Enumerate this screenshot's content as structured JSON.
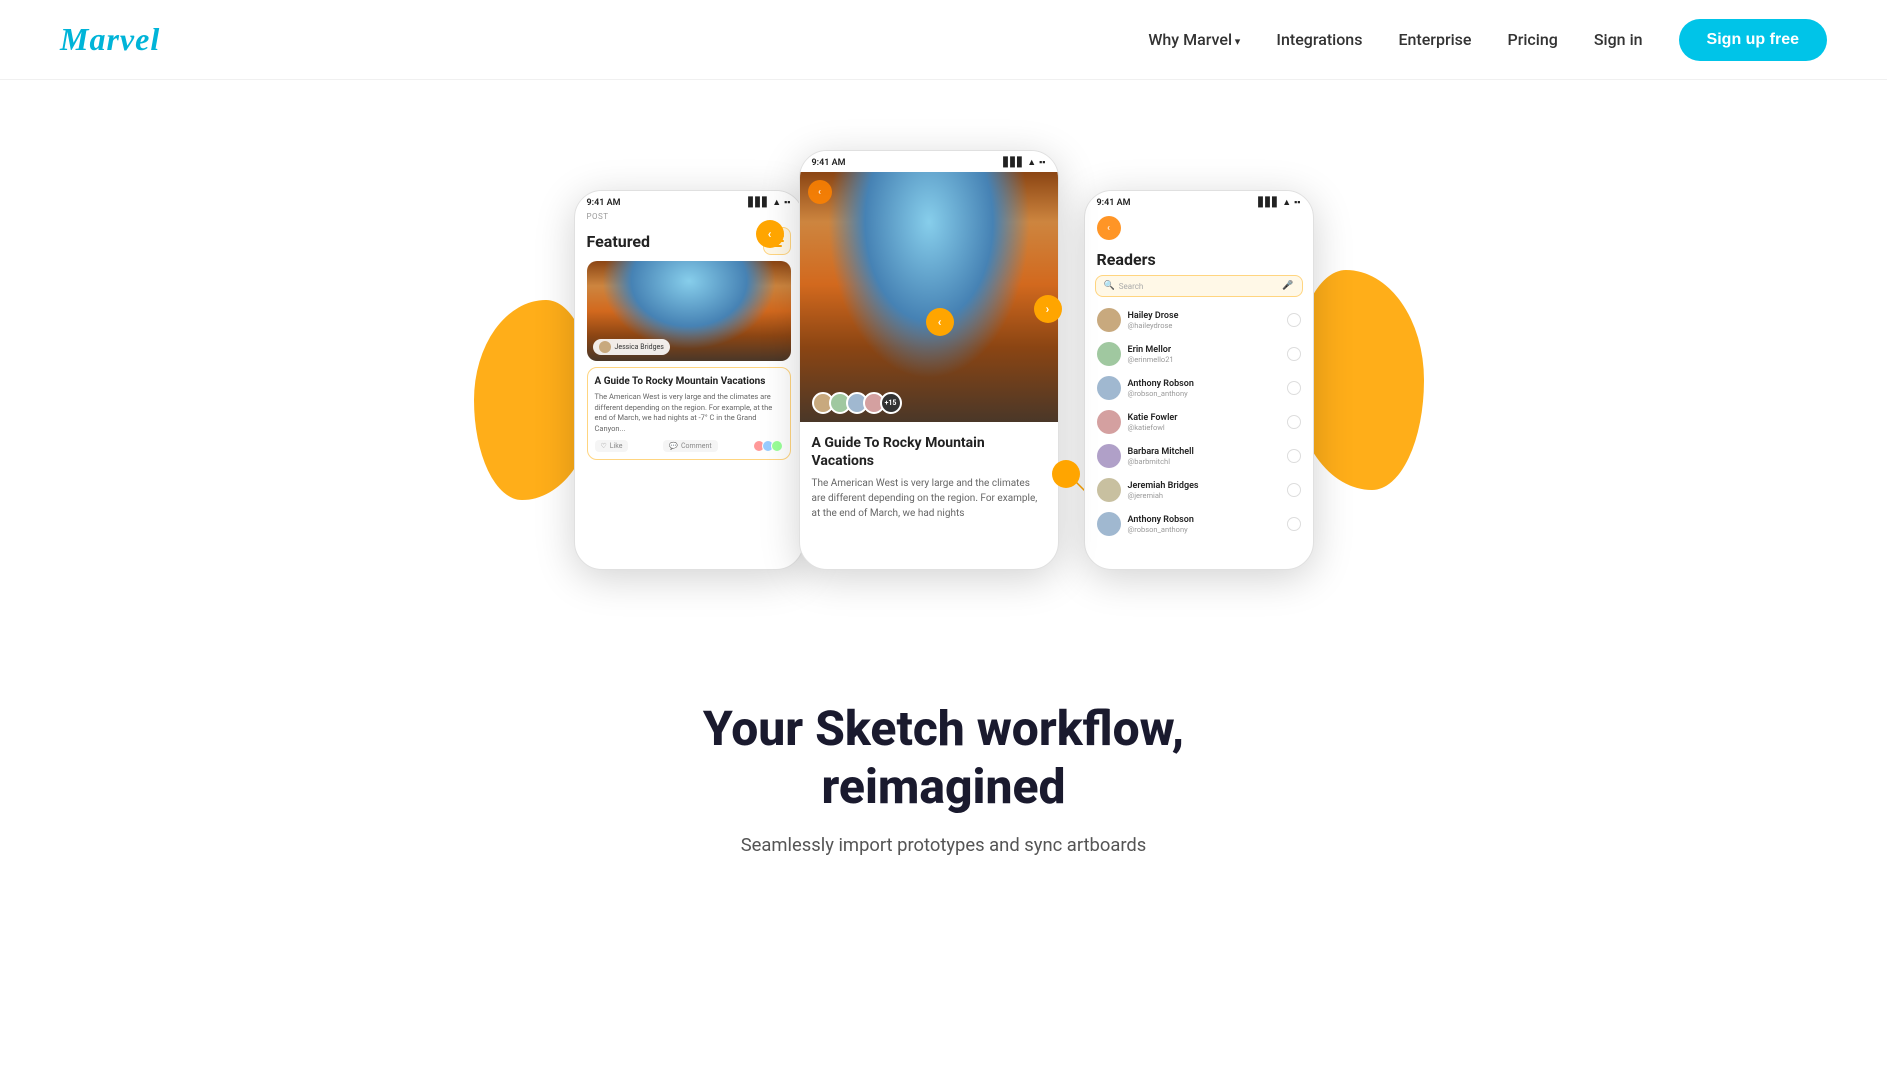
{
  "nav": {
    "logo": "Marvel",
    "links": [
      {
        "label": "Why Marvel",
        "id": "why-marvel",
        "hasArrow": true
      },
      {
        "label": "Integrations",
        "id": "integrations",
        "hasArrow": false
      },
      {
        "label": "Enterprise",
        "id": "enterprise",
        "hasArrow": false
      },
      {
        "label": "Pricing",
        "id": "pricing",
        "hasArrow": false
      },
      {
        "label": "Sign in",
        "id": "signin",
        "hasArrow": false
      }
    ],
    "cta": "Sign up free"
  },
  "phones": {
    "left": {
      "statusTime": "9:41 AM",
      "postLabel": "POST",
      "headerTitle": "Featured",
      "authorName": "Jessica Bridges",
      "articleTitle": "A Guide To Rocky Mountain Vacations",
      "articleBody": "The American West is very large and the climates are different depending on the region. For example, at the end of March, we had nights at -7° C in the Grand Canyon...",
      "likeLabel": "Like",
      "commentLabel": "Comment"
    },
    "center": {
      "statusTime": "9:41 AM",
      "articleTitle": "A Guide To Rocky Mountain Vacations",
      "articleBody": "The American West is very large and the climates are different depending on the region. For example, at the end of March, we had nights",
      "avatarMore": "+15"
    },
    "right": {
      "statusTime": "9:41 AM",
      "title": "Readers",
      "searchPlaceholder": "Search",
      "readers": [
        {
          "name": "Hailey Drose",
          "handle": "@haileydrose",
          "color": "#c8a97e"
        },
        {
          "name": "Erin Mellor",
          "handle": "@erinmello21",
          "color": "#a0c8a0"
        },
        {
          "name": "Anthony Robson",
          "handle": "@robson_anthony",
          "color": "#a0b8d0"
        },
        {
          "name": "Katie Fowler",
          "handle": "@katiefowl",
          "color": "#d4a0a0"
        },
        {
          "name": "Barbara Mitchell",
          "handle": "@barbmitchl",
          "color": "#b0a0c8"
        },
        {
          "name": "Jeremiah Bridges",
          "handle": "@jeremiah",
          "color": "#c8c0a0"
        },
        {
          "name": "Anthony Robson",
          "handle": "@robson_anthony",
          "color": "#a0b8d0"
        }
      ]
    }
  },
  "hero": {
    "title": "Your Sketch workflow, reimagined",
    "subtitle": "Seamlessly import prototypes and sync artboards"
  },
  "navDots": {
    "top": "‹",
    "left": "‹",
    "right": "›"
  }
}
